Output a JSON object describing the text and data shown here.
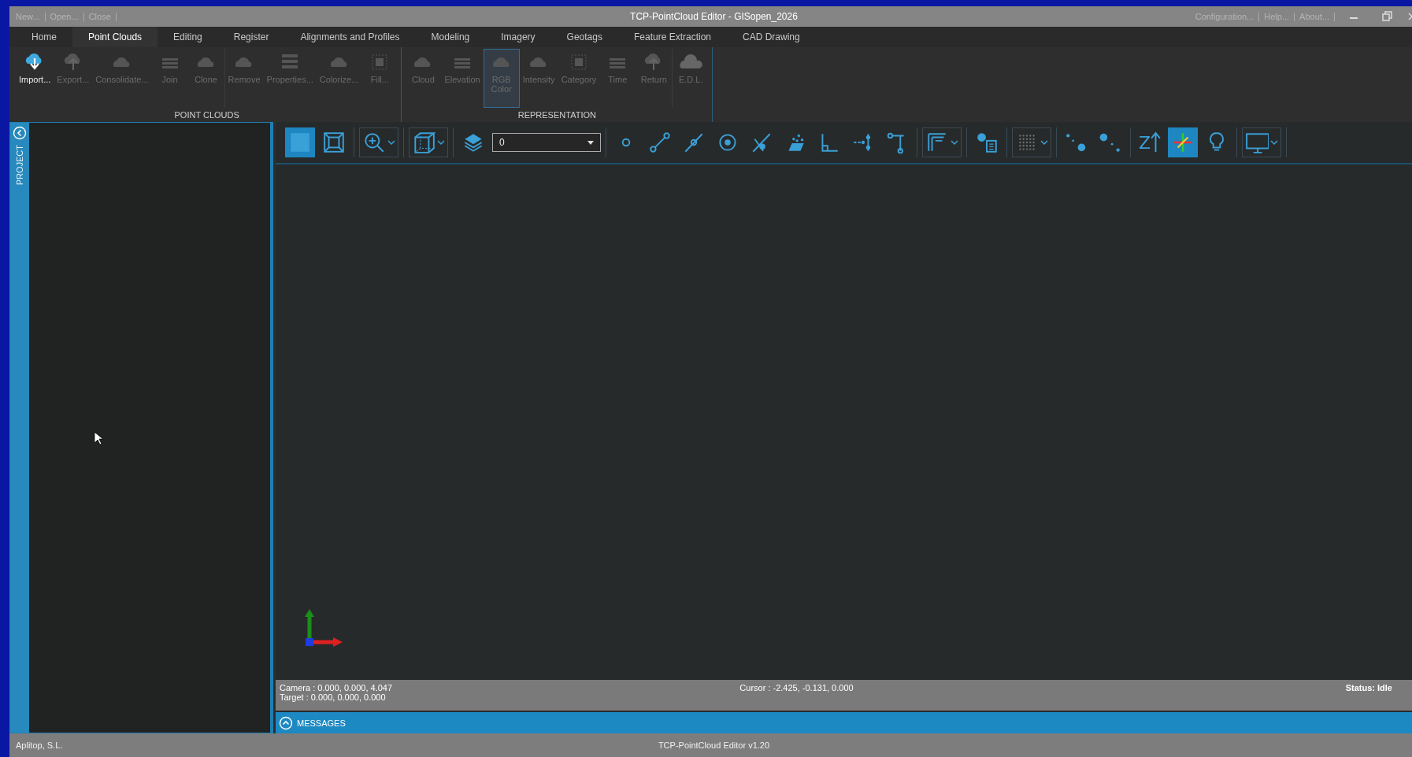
{
  "window": {
    "title": "TCP-PointCloud Editor - GISopen_2026",
    "file_menu": [
      "New...",
      "Open...",
      "Close"
    ],
    "help_menu": [
      "Configuration...",
      "Help...",
      "About..."
    ]
  },
  "tabs": [
    {
      "label": "Home",
      "selected": false
    },
    {
      "label": "Point Clouds",
      "selected": true
    },
    {
      "label": "Editing",
      "selected": false
    },
    {
      "label": "Register",
      "selected": false
    },
    {
      "label": "Alignments and Profiles",
      "selected": false
    },
    {
      "label": "Modeling",
      "selected": false
    },
    {
      "label": "Imagery",
      "selected": false
    },
    {
      "label": "Geotags",
      "selected": false
    },
    {
      "label": "Feature Extraction",
      "selected": false
    },
    {
      "label": "CAD Drawing",
      "selected": false
    }
  ],
  "ribbon": {
    "groups": [
      {
        "title": "POINT CLOUDS",
        "sections": [
          [
            {
              "label": "Import...",
              "kind": "import",
              "disabled": false,
              "selected": false
            },
            {
              "label": "Export...",
              "kind": "export",
              "disabled": true,
              "selected": false
            },
            {
              "label": "Consolidate...",
              "kind": "cloud",
              "disabled": true,
              "selected": false
            },
            {
              "label": "Join",
              "kind": "bars",
              "disabled": true,
              "selected": false
            },
            {
              "label": "Clone",
              "kind": "cloud",
              "disabled": true,
              "selected": false
            }
          ],
          [
            {
              "label": "Remove",
              "kind": "cloud",
              "disabled": true,
              "selected": false
            },
            {
              "label": "Properties...",
              "kind": "list",
              "disabled": true,
              "selected": false
            },
            {
              "label": "Colorize...",
              "kind": "cloud",
              "disabled": true,
              "selected": false
            },
            {
              "label": "Fill...",
              "kind": "grid",
              "disabled": true,
              "selected": false
            }
          ]
        ]
      },
      {
        "title": "REPRESENTATION",
        "sections": [
          [
            {
              "label": "Cloud",
              "kind": "cloud",
              "disabled": true,
              "selected": false
            },
            {
              "label": "Elevation",
              "kind": "bars",
              "disabled": true,
              "selected": false
            },
            {
              "label": "RGB Color",
              "kind": "cloud",
              "disabled": true,
              "selected": true
            },
            {
              "label": "Intensity",
              "kind": "cloud",
              "disabled": true,
              "selected": false
            },
            {
              "label": "Category",
              "kind": "grid",
              "disabled": true,
              "selected": false
            },
            {
              "label": "Time",
              "kind": "bars",
              "disabled": true,
              "selected": false
            },
            {
              "label": "Return",
              "kind": "export",
              "disabled": true,
              "selected": false
            }
          ],
          [
            {
              "label": "E.D.L.",
              "kind": "bigcloud",
              "disabled": true,
              "selected": false
            }
          ]
        ]
      }
    ]
  },
  "project_panel": {
    "title": "PROJECT"
  },
  "toolbar": {
    "groups": [
      [
        {
          "kind": "fill-square",
          "selected": true
        },
        {
          "kind": "frame-square",
          "selected": false
        }
      ],
      [
        {
          "kind": "zoom",
          "selected": false,
          "caret": true
        }
      ],
      [
        {
          "kind": "cube",
          "selected": false,
          "caret": true
        }
      ],
      [
        {
          "kind": "layers",
          "selected": false
        },
        {
          "kind": "combo",
          "value": "0"
        }
      ],
      [
        {
          "kind": "point",
          "selected": false
        },
        {
          "kind": "line",
          "selected": false
        },
        {
          "kind": "line-mid",
          "selected": false
        },
        {
          "kind": "target",
          "selected": false
        },
        {
          "kind": "snap",
          "selected": false
        },
        {
          "kind": "surface",
          "selected": false
        },
        {
          "kind": "angle",
          "selected": false
        },
        {
          "kind": "hsplit",
          "selected": false
        },
        {
          "kind": "vbar",
          "selected": false
        }
      ],
      [
        {
          "kind": "frame-f",
          "selected": false,
          "caret": true
        }
      ],
      [
        {
          "kind": "point-list",
          "selected": false
        }
      ],
      [
        {
          "kind": "grid",
          "selected": false,
          "caret": true
        }
      ],
      [
        {
          "kind": "dot-small",
          "selected": false
        },
        {
          "kind": "dot-large",
          "selected": false
        }
      ],
      [
        {
          "kind": "z-up",
          "label": "Z",
          "selected": false
        },
        {
          "kind": "axis",
          "selected": true
        },
        {
          "kind": "bulb",
          "selected": false
        }
      ],
      [
        {
          "kind": "monitor",
          "selected": false,
          "caret": true
        }
      ]
    ]
  },
  "viewport_status": {
    "camera": "Camera : 0.000, 0.000, 4.047",
    "target": "Target : 0.000, 0.000, 0.000",
    "cursor": "Cursor : -2.425, -0.131, 0.000",
    "status": "Status: Idle"
  },
  "messages": {
    "label": "MESSAGES"
  },
  "status_bar": {
    "company": "Aplitop, S.L.",
    "version": "TCP-PointCloud Editor v1.20"
  }
}
